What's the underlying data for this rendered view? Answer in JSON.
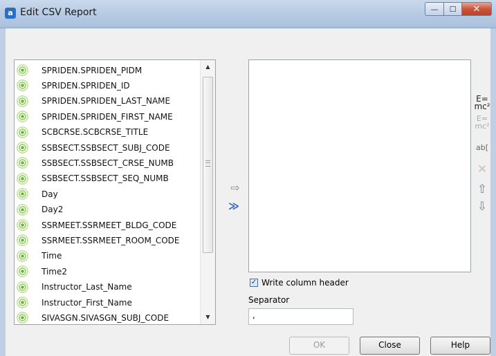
{
  "window": {
    "title": "Edit CSV Report",
    "app_icon_glyph": "a",
    "min_glyph": "—",
    "max_glyph": "☐",
    "close_glyph": "✕"
  },
  "fields": {
    "items": [
      "SPRIDEN.SPRIDEN_PIDM",
      "SPRIDEN.SPRIDEN_ID",
      "SPRIDEN.SPRIDEN_LAST_NAME",
      "SPRIDEN.SPRIDEN_FIRST_NAME",
      "SCBCRSE.SCBCRSE_TITLE",
      "SSBSECT.SSBSECT_SUBJ_CODE",
      "SSBSECT.SSBSECT_CRSE_NUMB",
      "SSBSECT.SSBSECT_SEQ_NUMB",
      "Day",
      "Day2",
      "SSRMEET.SSRMEET_BLDG_CODE",
      "SSRMEET.SSRMEET_ROOM_CODE",
      "Time",
      "Time2",
      "Instructor_Last_Name",
      "Instructor_First_Name",
      "SIVASGN.SIVASGN_SUBJ_CODE"
    ],
    "scroll_up_glyph": "▲",
    "scroll_down_glyph": "▼"
  },
  "move": {
    "add_one_glyph": "⇨",
    "add_all_glyph": "≫"
  },
  "side_tools": {
    "formula_main": "E=",
    "formula_sub": "mc²",
    "formula_edit": "E=",
    "formula_edit_sub": "mc²",
    "rename": "ab[",
    "delete": "✕",
    "up": "⇧",
    "down": "⇩"
  },
  "options": {
    "write_header_label": "Write column header",
    "write_header_checked_glyph": "✓",
    "separator_label": "Separator",
    "separator_value": ","
  },
  "buttons": {
    "ok": "OK",
    "close": "Close",
    "help": "Help"
  },
  "colors": {
    "titlebar": "#b7cbe3",
    "close_button": "#c9553a",
    "field_icon": "#5fb92e"
  }
}
